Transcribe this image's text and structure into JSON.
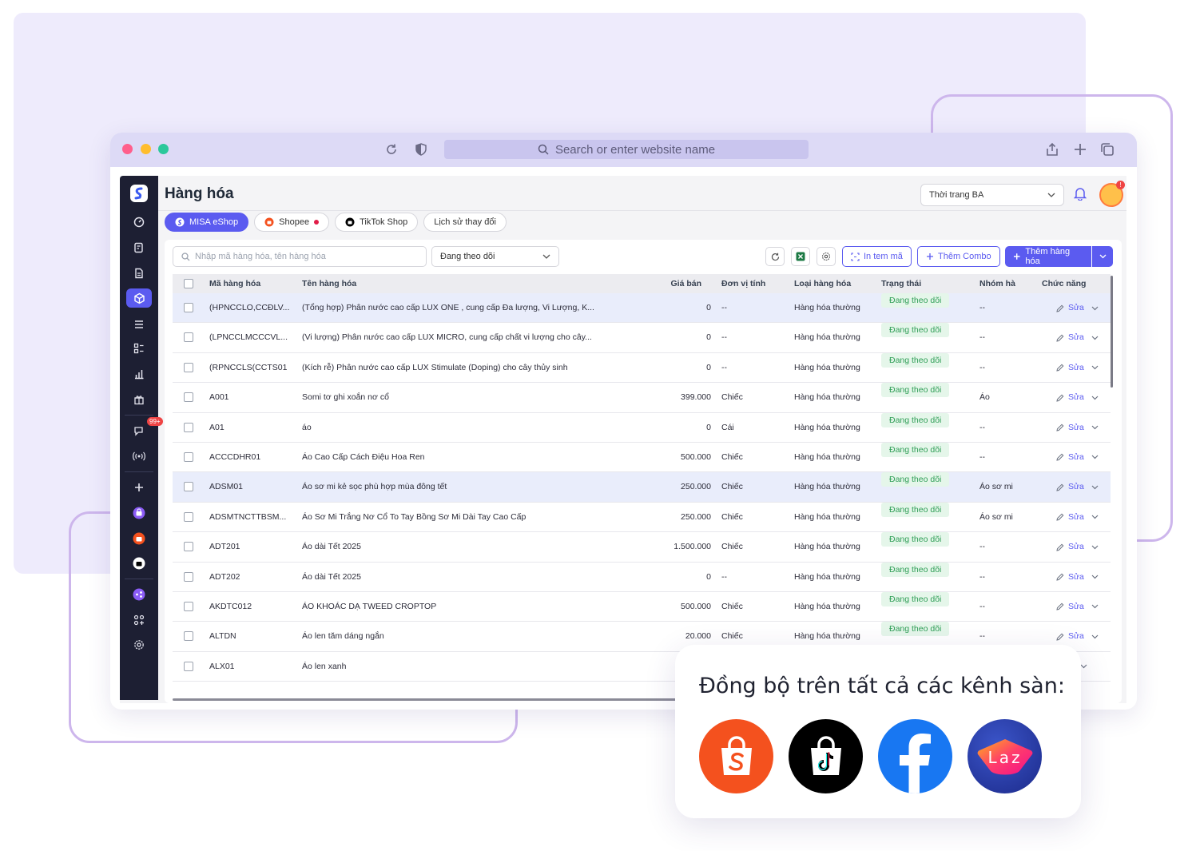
{
  "browser": {
    "address_placeholder": "Search or enter website name"
  },
  "app": {
    "page_title": "Hàng hóa",
    "store_select": "Thời trang BA",
    "avatar_badge": "!",
    "sidebar_badge": "99+"
  },
  "tabs": [
    {
      "label": "MISA eShop",
      "active": true
    },
    {
      "label": "Shopee",
      "active": false
    },
    {
      "label": "TikTok Shop",
      "active": false
    },
    {
      "label": "Lịch sử thay đổi",
      "active": false
    }
  ],
  "toolbar": {
    "search_placeholder": "Nhập mã hàng hóa, tên hàng hóa",
    "filter_value": "Đang theo dõi",
    "print_label": "In tem mã",
    "combo_label": "Thêm Combo",
    "add_label": "Thêm hàng hóa"
  },
  "table": {
    "headers": {
      "code": "Mã hàng hóa",
      "name": "Tên hàng hóa",
      "price": "Giá bán",
      "unit": "Đơn vị tính",
      "type": "Loại hàng hóa",
      "status": "Trạng thái",
      "group": "Nhóm hà",
      "action": "Chức năng"
    },
    "rows": [
      {
        "code": "(HPNCCLO,CCĐLV...",
        "name": "(Tổng hợp) Phân nước cao cấp LUX ONE , cung cấp Đa lượng, Vi Lượng, K...",
        "price": "0",
        "unit": "--",
        "type": "Hàng hóa thường",
        "status": "Đang theo dõi",
        "group": "--",
        "action": "Sửa"
      },
      {
        "code": "(LPNCCLMCCCVL...",
        "name": "(Vi lượng) Phân nước cao cấp LUX MICRO, cung cấp chất vi lượng cho cây...",
        "price": "0",
        "unit": "--",
        "type": "Hàng hóa thường",
        "status": "Đang theo dõi",
        "group": "--",
        "action": "Sửa"
      },
      {
        "code": "(RPNCCLS(CCTS01",
        "name": "(Kích rễ) Phân nước cao cấp LUX Stimulate (Doping) cho cây thủy sinh",
        "price": "0",
        "unit": "--",
        "type": "Hàng hóa thường",
        "status": "Đang theo dõi",
        "group": "--",
        "action": "Sửa"
      },
      {
        "code": "A001",
        "name": "Somi tơ ghi xoắn nơ cổ",
        "price": "399.000",
        "unit": "Chiếc",
        "type": "Hàng hóa thường",
        "status": "Đang theo dõi",
        "group": "Áo",
        "action": "Sửa"
      },
      {
        "code": "A01",
        "name": "áo",
        "price": "0",
        "unit": "Cái",
        "type": "Hàng hóa thường",
        "status": "Đang theo dõi",
        "group": "--",
        "action": "Sửa"
      },
      {
        "code": "ACCCDHR01",
        "name": "Áo Cao Cấp Cách Điệu Hoa Ren",
        "price": "500.000",
        "unit": "Chiếc",
        "type": "Hàng hóa thường",
        "status": "Đang theo dõi",
        "group": "--",
        "action": "Sửa"
      },
      {
        "code": "ADSM01",
        "name": "Áo sơ mi kẻ sọc phù hợp mùa đông tết",
        "price": "250.000",
        "unit": "Chiếc",
        "type": "Hàng hóa thường",
        "status": "Đang theo dõi",
        "group": "Áo sơ mi",
        "action": "Sửa"
      },
      {
        "code": "ADSMTNCTTBSM...",
        "name": "Áo Sơ Mi Trắng Nơ Cổ To Tay Bồng Sơ Mi Dài Tay Cao Cấp",
        "price": "250.000",
        "unit": "Chiếc",
        "type": "Hàng hóa thường",
        "status": "Đang theo dõi",
        "group": "Áo sơ mi",
        "action": "Sửa"
      },
      {
        "code": "ADT201",
        "name": "Áo dài Tết 2025",
        "price": "1.500.000",
        "unit": "Chiếc",
        "type": "Hàng hóa thường",
        "status": "Đang theo dõi",
        "group": "--",
        "action": "Sửa"
      },
      {
        "code": "ADT202",
        "name": "Áo dài Tết 2025",
        "price": "0",
        "unit": "--",
        "type": "Hàng hóa thường",
        "status": "Đang theo dõi",
        "group": "--",
        "action": "Sửa"
      },
      {
        "code": "AKDTC012",
        "name": "ÁO KHOÁC DẠ TWEED CROPTOP",
        "price": "500.000",
        "unit": "Chiếc",
        "type": "Hàng hóa thường",
        "status": "Đang theo dõi",
        "group": "--",
        "action": "Sửa"
      },
      {
        "code": "ALTDN",
        "name": "Áo len tăm dáng ngắn",
        "price": "20.000",
        "unit": "Chiếc",
        "type": "Hàng hóa thường",
        "status": "Đang theo dõi",
        "group": "--",
        "action": "Sửa"
      },
      {
        "code": "ALX01",
        "name": "Áo len xanh",
        "price": "",
        "unit": "",
        "type": "",
        "status": "",
        "group": "",
        "action": "a"
      }
    ]
  },
  "channels": {
    "title": "Đồng bộ trên tất cả các kênh sàn:",
    "items": [
      {
        "icon": "shopee-icon",
        "color": "#f4511e"
      },
      {
        "icon": "tiktok-shop-icon",
        "color": "#000000"
      },
      {
        "icon": "facebook-icon",
        "color": "#1877f2"
      },
      {
        "icon": "lazada-icon",
        "color": "#2a2f9e",
        "text": "Laz"
      }
    ]
  },
  "colors": {
    "accent": "#5b5bf0",
    "sidebar": "#1d1f33",
    "status_bg": "#e5f6ea",
    "status_text": "#2f9e56"
  }
}
